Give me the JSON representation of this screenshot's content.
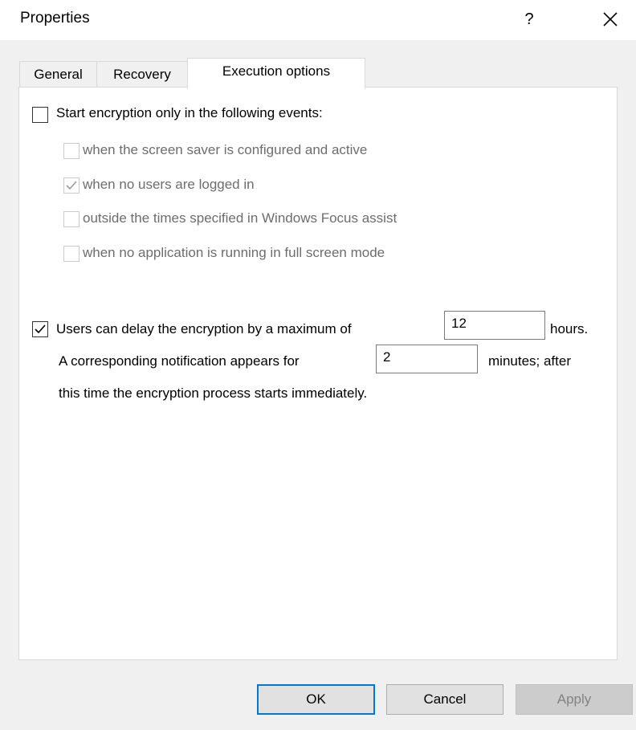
{
  "window": {
    "title": "Properties",
    "help_label": "?",
    "close_icon": "close-icon"
  },
  "tabs": [
    {
      "label": "General",
      "active": false
    },
    {
      "label": "Recovery",
      "active": false
    },
    {
      "label": "Execution options",
      "active": true
    }
  ],
  "execution_options": {
    "start_only_events": {
      "label": "Start encryption only in the following events:",
      "checked": false
    },
    "events": [
      {
        "label": "when the screen saver is configured and active",
        "checked": false,
        "enabled": false
      },
      {
        "label": "when no users are logged in",
        "checked": true,
        "enabled": false
      },
      {
        "label": "outside the times specified in Windows Focus assist",
        "checked": false,
        "enabled": false
      },
      {
        "label": "when no application is running in full screen mode",
        "checked": false,
        "enabled": false
      }
    ],
    "delay": {
      "label": "Users can delay the encryption by a maximum of",
      "checked": true,
      "hours_value": "12",
      "hours_unit": "hours.",
      "notification_label": "A corresponding notification appears for",
      "minutes_value": "2",
      "minutes_unit": "minutes; after",
      "trailing_text": "this time the encryption process starts immediately."
    }
  },
  "buttons": {
    "ok": "OK",
    "cancel": "Cancel",
    "apply": "Apply"
  },
  "colors": {
    "accent": "#0078d7",
    "disabled_text": "#6d6d6d"
  }
}
